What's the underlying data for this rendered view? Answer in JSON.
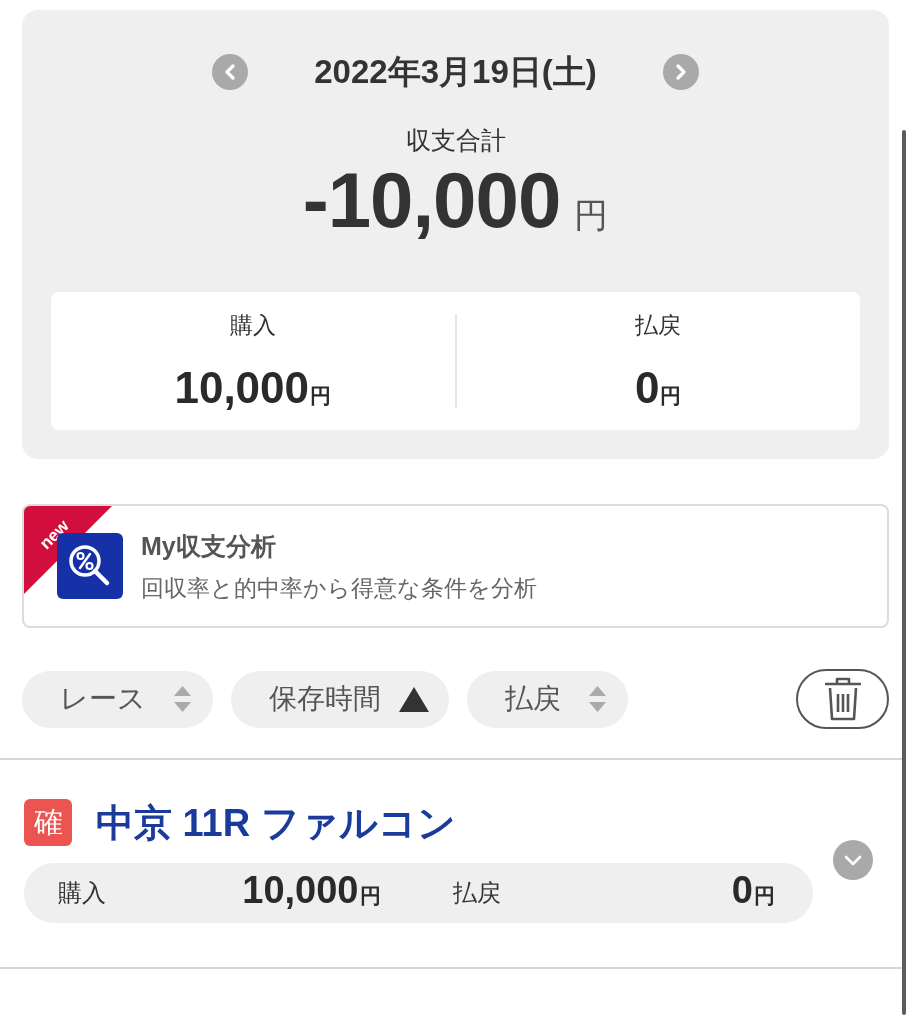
{
  "date_nav": {
    "date": "2022年3月19日(土)"
  },
  "summary": {
    "label": "収支合計",
    "amount": "-10,000",
    "unit": "円",
    "totals": [
      {
        "label": "購入",
        "amount": "10,000",
        "unit": "円"
      },
      {
        "label": "払戻",
        "amount": "0",
        "unit": "円"
      }
    ]
  },
  "feature_banner": {
    "badge": "new",
    "title": "My収支分析",
    "description": "回収率と的中率から得意な条件を分析"
  },
  "sort_options": [
    {
      "label": "レース",
      "selected": false
    },
    {
      "label": "保存時間",
      "selected": true
    },
    {
      "label": "払戻",
      "selected": false
    }
  ],
  "races": [
    {
      "status": "確",
      "title": "中京 11R ファルコン",
      "expanded": false,
      "stats": [
        {
          "label": "購入",
          "amount": "10,000",
          "unit": "円"
        },
        {
          "label": "払戻",
          "amount": "0",
          "unit": "円"
        }
      ]
    }
  ]
}
